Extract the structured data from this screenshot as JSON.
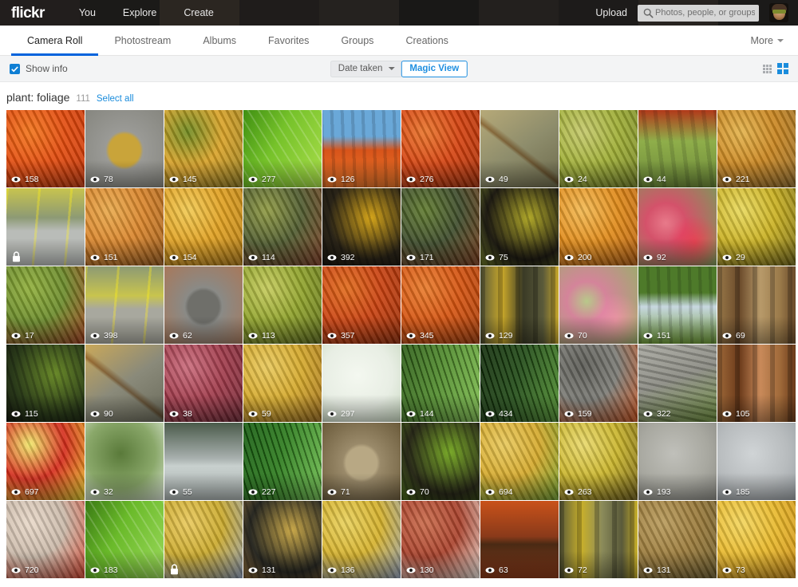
{
  "topnav": {
    "logo": "flickr",
    "links": [
      {
        "label": "You",
        "name": "nav-you"
      },
      {
        "label": "Explore",
        "name": "nav-explore"
      },
      {
        "label": "Create",
        "name": "nav-create"
      }
    ],
    "upload_label": "Upload",
    "search_placeholder": "Photos, people, or groups",
    "search_value": "",
    "avatar_name": "user-avatar",
    "background_colors": [
      "#2a2320",
      "#1c1a18",
      "#3a3028",
      "#241f1c",
      "#2e2a24",
      "#191715",
      "#2b2622",
      "#211d1a",
      "#332c26",
      "#1d1b19"
    ]
  },
  "tabs": {
    "items": [
      {
        "label": "Camera Roll",
        "active": true
      },
      {
        "label": "Photostream",
        "active": false
      },
      {
        "label": "Albums",
        "active": false
      },
      {
        "label": "Favorites",
        "active": false
      },
      {
        "label": "Groups",
        "active": false
      },
      {
        "label": "Creations",
        "active": false
      }
    ],
    "more_label": "More",
    "active_underline_color": "#0063dc"
  },
  "toolbar": {
    "show_info_label": "Show info",
    "show_info_checked": true,
    "checkbox_color": "#0f7fd4",
    "date_select_label": "Date taken",
    "magic_view_label": "Magic View",
    "magic_view_color": "#1f8fe0",
    "view_dense_icon": "dense-grid-icon",
    "view_big_icon": "large-grid-icon",
    "view_dense_color": "#a9acb0",
    "view_big_color": "#1a8cdc"
  },
  "album": {
    "title": "plant: foliage",
    "count": "111",
    "select_all_label": "Select all"
  },
  "photos": [
    {
      "views": "158",
      "private": false,
      "c1": "#e24a0c",
      "c2": "#c23408",
      "c3": "#f2741a",
      "style": "texture"
    },
    {
      "views": "78",
      "private": false,
      "c1": "#9a9a96",
      "c2": "#86867f",
      "c3": "#c9a43a",
      "style": "leaf-gray"
    },
    {
      "views": "145",
      "private": false,
      "c1": "#d9a227",
      "c2": "#8f7a1e",
      "c3": "#6f8a20",
      "style": "texture"
    },
    {
      "views": "277",
      "private": false,
      "c1": "#76c22a",
      "c2": "#3f8f12",
      "c3": "#a8dd4a",
      "style": "leafvein"
    },
    {
      "views": "126",
      "private": false,
      "c1": "#6aa8d8",
      "c2": "#d8541a",
      "c3": "#e8762a",
      "style": "skytrees"
    },
    {
      "views": "276",
      "private": false,
      "c1": "#d4410e",
      "c2": "#a02c06",
      "c3": "#e8742a",
      "style": "texture"
    },
    {
      "views": "49",
      "private": false,
      "c1": "#8e8d6c",
      "c2": "#b6a978",
      "c3": "#6d6a4c",
      "style": "branch"
    },
    {
      "views": "24",
      "private": false,
      "c1": "#9fae35",
      "c2": "#6f7f22",
      "c3": "#c4c86a",
      "style": "texture"
    },
    {
      "views": "44",
      "private": false,
      "c1": "#6d8a3a",
      "c2": "#b23a1a",
      "c3": "#8fae4a",
      "style": "hillside"
    },
    {
      "views": "221",
      "private": false,
      "c1": "#c9851f",
      "c2": "#8f6a2a",
      "c3": "#e3b24a",
      "style": "texture"
    },
    {
      "views": "",
      "private": true,
      "c1": "#b9bcb8",
      "c2": "#8d9a74",
      "c3": "#c8c44e",
      "style": "road"
    },
    {
      "views": "151",
      "private": false,
      "c1": "#d9842a",
      "c2": "#9a5a1a",
      "c3": "#e8a84a",
      "style": "texture"
    },
    {
      "views": "154",
      "private": false,
      "c1": "#e0a020",
      "c2": "#b07a14",
      "c3": "#f0c850",
      "style": "texture"
    },
    {
      "views": "114",
      "private": false,
      "c1": "#4e5a2e",
      "c2": "#7d3a22",
      "c3": "#8f9a42",
      "style": "texture"
    },
    {
      "views": "392",
      "private": false,
      "c1": "#2a2418",
      "c2": "#d4a41a",
      "c3": "#1a1710",
      "style": "darkgold"
    },
    {
      "views": "171",
      "private": false,
      "c1": "#3c4a2a",
      "c2": "#7a3a1a",
      "c3": "#5f7a2e",
      "style": "texture"
    },
    {
      "views": "75",
      "private": false,
      "c1": "#1f1c14",
      "c2": "#b0a82a",
      "c3": "#6f7a2a",
      "style": "darkgold"
    },
    {
      "views": "200",
      "private": false,
      "c1": "#e08a18",
      "c2": "#b05a0e",
      "c3": "#f2b850",
      "style": "texture"
    },
    {
      "views": "92",
      "private": false,
      "c1": "#7d9a5a",
      "c2": "#d4526a",
      "c3": "#e87a8a",
      "style": "blossom"
    },
    {
      "views": "29",
      "private": false,
      "c1": "#c9b020",
      "c2": "#6f6414",
      "c3": "#e8d85a",
      "style": "texture"
    },
    {
      "views": "17",
      "private": false,
      "c1": "#6a8a2a",
      "c2": "#a03a1a",
      "c3": "#8fae3a",
      "style": "texture"
    },
    {
      "views": "398",
      "private": false,
      "c1": "#a8a89e",
      "c2": "#c8c44e",
      "c3": "#8d9a74",
      "style": "road"
    },
    {
      "views": "62",
      "private": false,
      "c1": "#8a8a86",
      "c2": "#a8785a",
      "c3": "#6f6f6a",
      "style": "leaf-gray"
    },
    {
      "views": "113",
      "private": false,
      "c1": "#8fa22a",
      "c2": "#5a6a18",
      "c3": "#c4ca5a",
      "style": "texture"
    },
    {
      "views": "357",
      "private": false,
      "c1": "#c9400e",
      "c2": "#8f2a06",
      "c3": "#e06a1a",
      "style": "texture"
    },
    {
      "views": "345",
      "private": false,
      "c1": "#d4520e",
      "c2": "#a03a08",
      "c3": "#e87a2a",
      "style": "texture"
    },
    {
      "views": "129",
      "private": false,
      "c1": "#5a5a3a",
      "c2": "#c9a82a",
      "c3": "#3a3a26",
      "style": "trunks"
    },
    {
      "views": "70",
      "private": false,
      "c1": "#9aae6a",
      "c2": "#d4849a",
      "c3": "#b8c88a",
      "style": "blossom"
    },
    {
      "views": "151",
      "private": false,
      "c1": "#4e7a2a",
      "c2": "#c8d8e0",
      "c3": "#6f9a3a",
      "style": "skytrees"
    },
    {
      "views": "69",
      "private": false,
      "c1": "#9a7a4a",
      "c2": "#6a4a2a",
      "c3": "#b89a6a",
      "style": "trunks"
    },
    {
      "views": "115",
      "private": false,
      "c1": "#2a3a1a",
      "c2": "#6a8a2a",
      "c3": "#14180e",
      "style": "darkgold"
    },
    {
      "views": "90",
      "private": false,
      "c1": "#8a8a7a",
      "c2": "#c9a85a",
      "c3": "#6a6a5a",
      "style": "branch"
    },
    {
      "views": "38",
      "private": false,
      "c1": "#a03a4a",
      "c2": "#6a2430",
      "c3": "#c96a7a",
      "style": "texture"
    },
    {
      "views": "59",
      "private": false,
      "c1": "#d4a82a",
      "c2": "#9a6a1a",
      "c3": "#e8c85a",
      "style": "texture"
    },
    {
      "views": "297",
      "private": false,
      "c1": "#e8eee4",
      "c2": "#c8d8c0",
      "c3": "#f4f8f0",
      "style": "pale",
      "faint": true
    },
    {
      "views": "144",
      "private": false,
      "c1": "#4e8a2a",
      "c2": "#2a5a14",
      "c3": "#7aba4a",
      "style": "fern"
    },
    {
      "views": "434",
      "private": false,
      "c1": "#1f4a14",
      "c2": "#0f2a08",
      "c3": "#4a8a2a",
      "style": "fern"
    },
    {
      "views": "159",
      "private": false,
      "c1": "#7a7a74",
      "c2": "#c9501a",
      "c3": "#5a5a54",
      "style": "texture"
    },
    {
      "views": "322",
      "private": false,
      "c1": "#8a8a82",
      "c2": "#6a8a3a",
      "c3": "#a8a8a0",
      "style": "rock"
    },
    {
      "views": "105",
      "private": false,
      "c1": "#a06a3a",
      "c2": "#6a3a1a",
      "c3": "#c98a5a",
      "style": "trunks"
    },
    {
      "views": "697",
      "private": false,
      "c1": "#d42a1a",
      "c2": "#e8d42a",
      "c3": "#f0e86a",
      "style": "texture"
    },
    {
      "views": "32",
      "private": false,
      "c1": "#8aa86a",
      "c2": "#dde8d8",
      "c3": "#5a7a3a",
      "style": "pale"
    },
    {
      "views": "55",
      "private": false,
      "c1": "#a8b0ae",
      "c2": "#4a5a4a",
      "c3": "#c8d0ce",
      "style": "lake"
    },
    {
      "views": "227",
      "private": false,
      "c1": "#2a7a1a",
      "c2": "#145a0e",
      "c3": "#6aba4a",
      "style": "fern"
    },
    {
      "views": "71",
      "private": false,
      "c1": "#9a8a6a",
      "c2": "#6a5a3a",
      "c3": "#b8a884",
      "style": "leaf-gray"
    },
    {
      "views": "70",
      "private": false,
      "c1": "#2a2a1a",
      "c2": "#7aaa2a",
      "c3": "#4a6a1a",
      "style": "darkgold"
    },
    {
      "views": "694",
      "private": false,
      "c1": "#d4a82a",
      "c2": "#6a9a2a",
      "c3": "#e8c85a",
      "style": "texture"
    },
    {
      "views": "263",
      "private": false,
      "c1": "#c9b42a",
      "c2": "#6a5a14",
      "c3": "#e8d86a",
      "style": "texture"
    },
    {
      "views": "193",
      "private": false,
      "c1": "#a8a8a0",
      "c2": "#8a8a84",
      "c3": "#c0c0ba",
      "style": "pale"
    },
    {
      "views": "185",
      "private": false,
      "c1": "#b8bcbe",
      "c2": "#9aa0a4",
      "c3": "#d0d4d6",
      "style": "pale"
    },
    {
      "views": "720",
      "private": false,
      "c1": "#c9b8a8",
      "c2": "#d4402a",
      "c3": "#e8d8c8",
      "style": "texture"
    },
    {
      "views": "183",
      "private": false,
      "c1": "#6aba2a",
      "c2": "#3a7a14",
      "c3": "#9ad85a",
      "style": "leafvein"
    },
    {
      "views": "",
      "private": true,
      "c1": "#c9a82a",
      "c2": "#8a9ab8",
      "c3": "#e8c85a",
      "style": "texture"
    },
    {
      "views": "131",
      "private": false,
      "c1": "#2a2a24",
      "c2": "#c9a84a",
      "c3": "#8a6a3a",
      "style": "darkgold"
    },
    {
      "views": "136",
      "private": false,
      "c1": "#d4b02a",
      "c2": "#8a9ab8",
      "c3": "#e8d05a",
      "style": "texture"
    },
    {
      "views": "130",
      "private": false,
      "c1": "#a8402a",
      "c2": "#e8e0d8",
      "c3": "#c96a4a",
      "style": "texture"
    },
    {
      "views": "63",
      "private": false,
      "c1": "#8a3a1a",
      "c2": "#c9521a",
      "c3": "#4a2a14",
      "style": "lake"
    },
    {
      "views": "72",
      "private": false,
      "c1": "#5a5a3a",
      "c2": "#c9b02a",
      "c3": "#8a8a5a",
      "style": "trunks"
    },
    {
      "views": "131",
      "private": false,
      "c1": "#9a7a3a",
      "c2": "#6a5a2a",
      "c3": "#b89a5a",
      "style": "texture"
    },
    {
      "views": "73",
      "private": false,
      "c1": "#e8b82a",
      "c2": "#c98a14",
      "c3": "#f2d45a",
      "style": "texture"
    }
  ]
}
